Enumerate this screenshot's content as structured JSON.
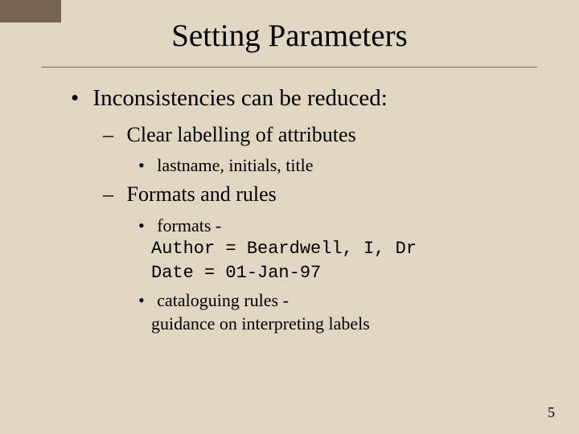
{
  "title": "Setting Parameters",
  "bullets": {
    "lvl1": "Inconsistencies can be reduced:",
    "a": {
      "head": "Clear labelling of attributes",
      "sub": "lastname, initials, title"
    },
    "b": {
      "head": "Formats and rules",
      "fmt": {
        "lead": "formats -",
        "author": "Author = Beardwell, I, Dr",
        "date": "Date = 01-Jan-97"
      },
      "cat": {
        "lead": "cataloguing rules -",
        "desc": "guidance on interpreting labels"
      }
    }
  },
  "page": "5"
}
